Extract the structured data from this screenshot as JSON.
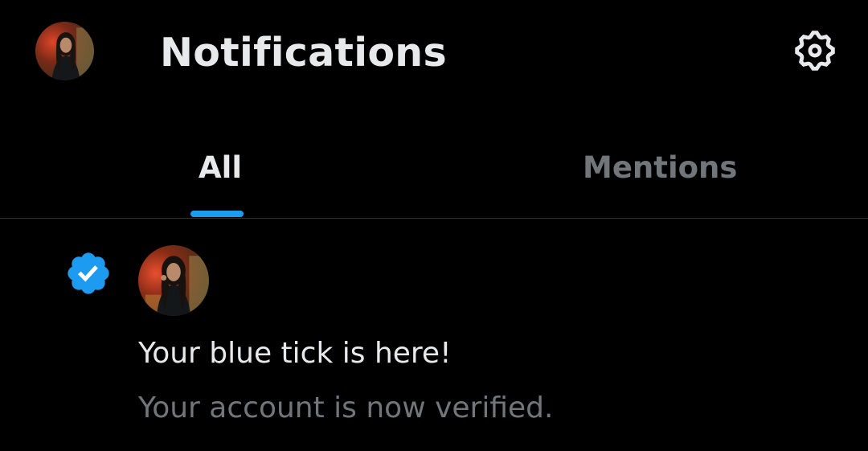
{
  "header": {
    "title": "Notifications",
    "avatar_icon": "profile-avatar",
    "settings_icon": "gear-icon"
  },
  "tabs": [
    {
      "label": "All",
      "selected": true
    },
    {
      "label": "Mentions",
      "selected": false
    }
  ],
  "notification": {
    "icon": "verified-badge-icon",
    "title": "Your blue tick is here!",
    "subtitle": "Your account is now verified."
  },
  "colors": {
    "background": "#000000",
    "primary_text": "#e7e9ea",
    "secondary_text": "#71767b",
    "accent": "#1d9bf0",
    "divider": "#2f3336"
  }
}
